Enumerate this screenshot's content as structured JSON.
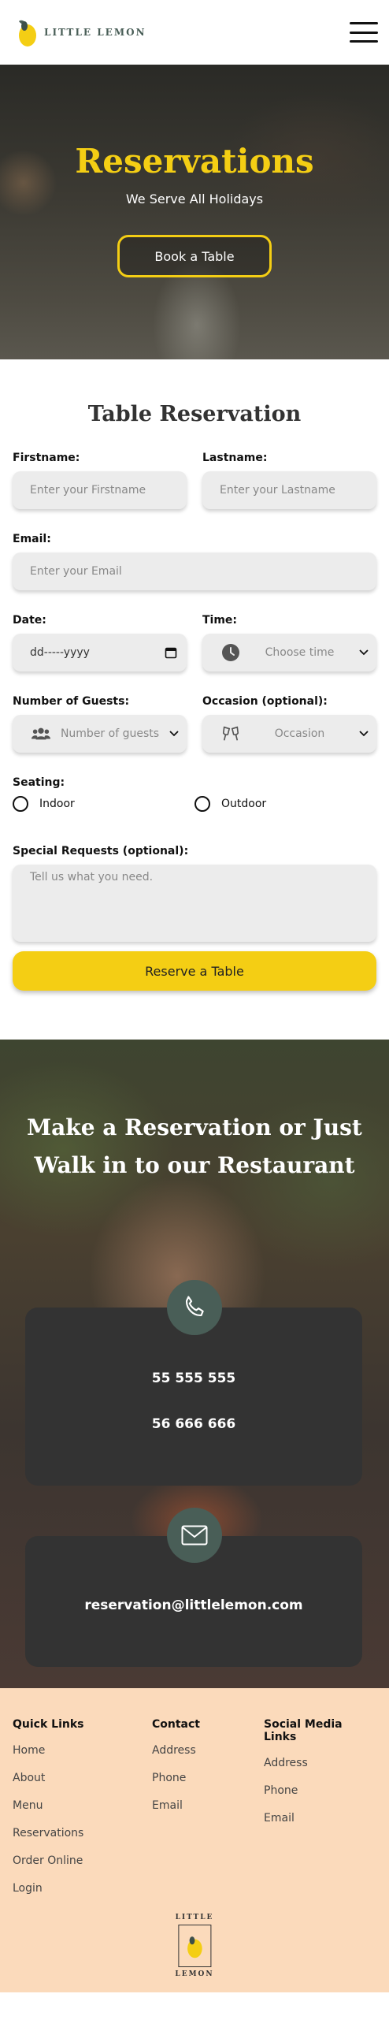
{
  "brand": {
    "name": "LITTLE LEMON",
    "footer_top": "LITTLE",
    "footer_bottom": "LEMON",
    "accent": "#F4CE14",
    "green": "#495E57"
  },
  "hero": {
    "title": "Reservations",
    "subtitle": "We Serve All Holidays",
    "button": "Book a Table"
  },
  "form": {
    "title": "Table Reservation",
    "firstname": {
      "label": "Firstname:",
      "placeholder": "Enter your Firstname"
    },
    "lastname": {
      "label": "Lastname:",
      "placeholder": "Enter your Lastname"
    },
    "email": {
      "label": "Email:",
      "placeholder": "Enter your Email"
    },
    "date": {
      "label": "Date:",
      "value": "dd-----yyyy"
    },
    "time": {
      "label": "Time:",
      "placeholder": "Choose time",
      "icon": "clock-icon"
    },
    "guests": {
      "label": "Number of Guests:",
      "placeholder": "Number of guests",
      "icon": "people-icon"
    },
    "occasion": {
      "label": "Occasion (optional):",
      "placeholder": "Occasion",
      "icon": "cheers-icon"
    },
    "seating": {
      "label": "Seating:",
      "options": [
        "Indoor",
        "Outdoor"
      ]
    },
    "requests": {
      "label": "Special Requests (optional):",
      "placeholder": "Tell us what you need."
    },
    "submit": "Reserve a Table"
  },
  "contact": {
    "title_line1": "Make a Reservation or Just",
    "title_line2": "Walk in to our Restaurant",
    "phone1": "55 555 555",
    "phone2": "56 666 666",
    "email": "reservation@littlelemon.com"
  },
  "footer": {
    "quick_links": {
      "heading": "Quick Links",
      "items": [
        "Home",
        "About",
        "Menu",
        "Reservations",
        "Order Online",
        "Login"
      ]
    },
    "contact": {
      "heading": "Contact",
      "items": [
        "Address",
        "Phone",
        "Email"
      ]
    },
    "social": {
      "heading": "Social Media Links",
      "items": [
        "Address",
        "Phone",
        "Email"
      ]
    }
  }
}
